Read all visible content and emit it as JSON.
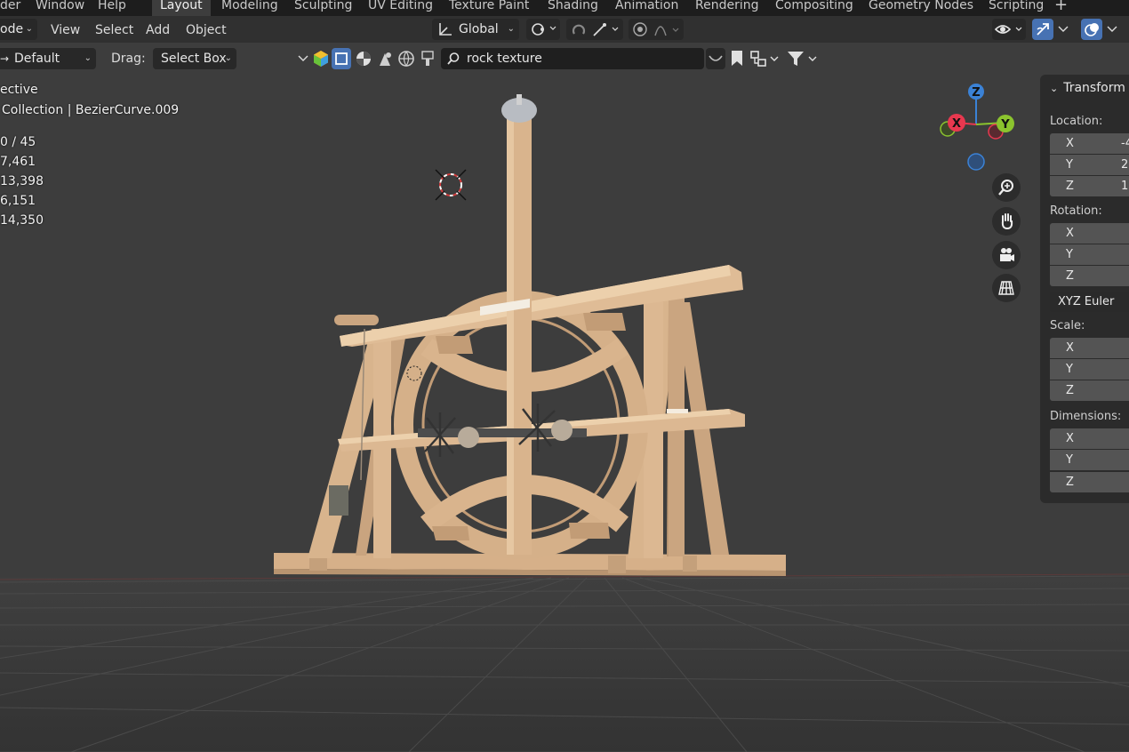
{
  "workspace_tabs": {
    "partial_menus": [
      "der",
      "Window",
      "Help"
    ],
    "tabs": [
      "Layout",
      "Modeling",
      "Sculpting",
      "UV Editing",
      "Texture Paint",
      "Shading",
      "Animation",
      "Rendering",
      "Compositing",
      "Geometry Nodes",
      "Scripting"
    ],
    "active_tab": "Layout",
    "add_label": "+"
  },
  "header": {
    "mode_label": "ode",
    "menus": [
      "View",
      "Select",
      "Add",
      "Object"
    ],
    "transform_orientation": "Global"
  },
  "toolbar": {
    "transform_pivot": "Default",
    "drag_label": "Drag:",
    "drag_value": "Select Box",
    "search_value": "rock texture"
  },
  "viewport_overlay": {
    "view_name": "ective",
    "collection_path": "Collection | BezierCurve.009",
    "stats": [
      "0 / 45",
      "7,461",
      "13,398",
      "6,151",
      "14,350"
    ]
  },
  "nav_gizmo": {
    "axes": [
      "Z",
      "X",
      "Y"
    ],
    "colors": {
      "x": "#e8384f",
      "y": "#8bc42e",
      "z": "#3b82d6"
    },
    "tools": [
      "zoom-icon",
      "pan-hand-icon",
      "camera-icon",
      "ortho-grid-icon"
    ]
  },
  "transform_panel": {
    "title": "Transform",
    "location_label": "Location:",
    "location": [
      {
        "axis": "X",
        "value": "-4"
      },
      {
        "axis": "Y",
        "value": "2"
      },
      {
        "axis": "Z",
        "value": "1"
      }
    ],
    "rotation_label": "Rotation:",
    "rotation": [
      {
        "axis": "X",
        "value": ""
      },
      {
        "axis": "Y",
        "value": ""
      },
      {
        "axis": "Z",
        "value": ""
      }
    ],
    "rotation_mode": "XYZ Euler",
    "scale_label": "Scale:",
    "scale": [
      {
        "axis": "X",
        "value": ""
      },
      {
        "axis": "Y",
        "value": ""
      },
      {
        "axis": "Z",
        "value": ""
      }
    ],
    "dimensions_label": "Dimensions:",
    "dimensions": [
      {
        "axis": "X",
        "value": ""
      },
      {
        "axis": "Y",
        "value": ""
      },
      {
        "axis": "Z",
        "value": ""
      }
    ]
  },
  "colors": {
    "accent": "#4772b3",
    "wood": "#d9b48e",
    "viewport_bg": "#3d3d3d"
  }
}
